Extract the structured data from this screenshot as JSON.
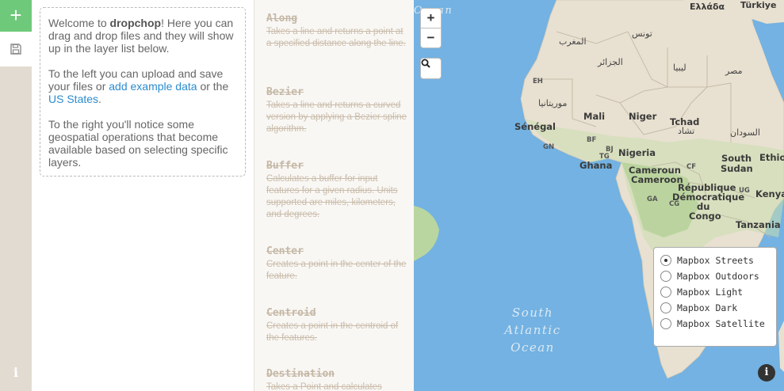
{
  "toolbar": {
    "add_icon": "plus-icon",
    "save_icon": "floppy-disk-icon",
    "info_icon": "info-icon",
    "add_color": "#6ec97a"
  },
  "welcome": {
    "p1_before": "Welcome to ",
    "p1_brand": "dropchop",
    "p1_after": "! Here you can drag and drop files and they will show up in the layer list below.",
    "p2_before": "To the left you can upload and save your files or ",
    "p2_link1": "add example data",
    "p2_mid": " or the ",
    "p2_link2": "US States",
    "p2_end": ".",
    "p3": "To the right you'll notice some geospatial operations that become available based on selecting specific layers."
  },
  "operations": [
    {
      "title": "Along",
      "desc": "Takes a line and returns a point at a specified distance along the line."
    },
    {
      "title": "Bezier",
      "desc": "Takes a line and returns a curved version by applying a Bezier spline algorithm."
    },
    {
      "title": "Buffer",
      "desc": "Calculates a buffer for input features for a given radius. Units supported are miles, kilometers, and degrees."
    },
    {
      "title": "Center",
      "desc": "Creates a point in the center of the feature."
    },
    {
      "title": "Centroid",
      "desc": "Creates a point in the centroid of the features."
    },
    {
      "title": "Destination",
      "desc": "Takes a Point and calculates"
    }
  ],
  "map": {
    "zoom_in": "+",
    "zoom_out": "−",
    "search_icon": "search-icon",
    "attribution_icon": "info-icon",
    "labels": {
      "ocean_top": "Ocean",
      "ellada": "Ελλάδα",
      "turkiye": "Türkiye",
      "tunis": "تونس",
      "maghrib": "المغرب",
      "jazair": "الجزائر",
      "libya": "ليبيا",
      "misr": "مصر",
      "eh": "EH",
      "mauritania": "موريتانيا",
      "mali": "Mali",
      "niger": "Niger",
      "tchad": "Tchad",
      "tchad_ar": "تشاد",
      "sudan_ar": "السودان",
      "senegal": "Sénégal",
      "gn": "GN",
      "bf": "BF",
      "bj": "BJ",
      "tg": "TG",
      "nigeria": "Nigeria",
      "ghana": "Ghana",
      "south_sudan": "South",
      "south_sudan2": "Sudan",
      "ethiopia": "Ethiop",
      "cameroun1": "Cameroun",
      "cameroun2": "Cameroon",
      "cf": "CF",
      "rdc1": "République",
      "rdc2": "Démocratique",
      "rdc3": "du",
      "rdc4": "Congo",
      "ga": "GA",
      "cg": "CG",
      "ug": "UG",
      "kenya": "Kenya",
      "tanzania": "Tanzania",
      "ocean_sa1": "South",
      "ocean_sa2": "Atlantic",
      "ocean_sa3": "Ocean"
    },
    "basemaps": [
      {
        "label": "Mapbox Streets",
        "selected": true
      },
      {
        "label": "Mapbox Outdoors",
        "selected": false
      },
      {
        "label": "Mapbox Light",
        "selected": false
      },
      {
        "label": "Mapbox Dark",
        "selected": false
      },
      {
        "label": "Mapbox Satellite",
        "selected": false
      }
    ],
    "colors": {
      "water": "#73b2e2",
      "land": "#e8e0d0",
      "vegetation": "#b9d6a0"
    }
  }
}
